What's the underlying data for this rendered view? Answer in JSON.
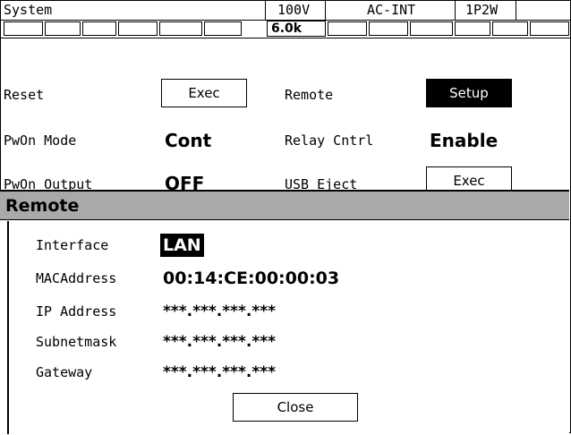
{
  "status_bar": {
    "title": "System",
    "voltage": "100V",
    "source": "AC-INT",
    "wiring": "1P2W"
  },
  "freq_box": "6.0k",
  "settings": {
    "reset_label": "Reset",
    "reset_button": "Exec",
    "remote_label": "Remote",
    "remote_button": "Setup",
    "pwon_mode_label": "PwOn Mode",
    "pwon_mode_value": "Cont",
    "relay_label": "Relay Cntrl",
    "relay_value": "Enable",
    "pwon_output_label": "PwOn Output",
    "pwon_output_value": "OFF",
    "usb_eject_label": "USB Eject",
    "usb_eject_button": "Exec"
  },
  "dialog": {
    "title": "Remote",
    "fields": [
      {
        "label": "Interface",
        "value": "LAN"
      },
      {
        "label": "MACAddress",
        "value": "00:14:CE:00:00:03"
      },
      {
        "label": "IP Address",
        "value": "***.***.***.***"
      },
      {
        "label": "Subnetmask",
        "value": "***.***.***.***"
      },
      {
        "label": "Gateway",
        "value": "***.***.***.***"
      }
    ],
    "close_label": "Close"
  }
}
